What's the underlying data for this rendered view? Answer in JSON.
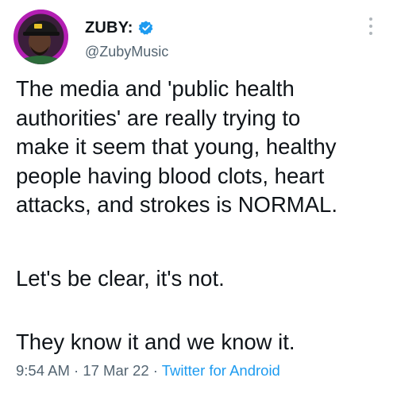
{
  "author": {
    "display_name": "ZUBY:",
    "handle": "@ZubyMusic",
    "avatar_icon": "profile-photo",
    "verified_icon": "verified-badge-icon"
  },
  "tweet": {
    "lines": [
      "The media and 'public health",
      "authorities' are really trying to",
      "make it seem that young, healthy",
      "people having blood clots, heart",
      "attacks, and strokes is NORMAL."
    ],
    "paragraph_2": "Let's be clear, it's not.",
    "paragraph_3": "They know it and we know it."
  },
  "meta": {
    "time": "9:54 AM",
    "separator": " · ",
    "date": "17 Mar 22",
    "source": "Twitter for Android"
  },
  "colors": {
    "verified": "#1d9bf0",
    "link": "#1d9bf0",
    "secondary_text": "#536471",
    "avatar_ring": "#b020b0"
  }
}
